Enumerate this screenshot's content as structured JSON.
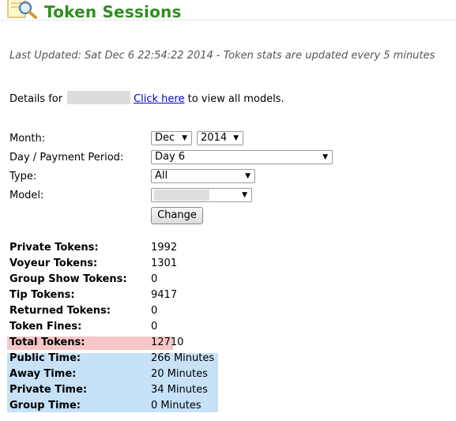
{
  "header": {
    "icon": "magnifier-document-icon",
    "title": "Token Sessions"
  },
  "last_updated": "Last Updated: Sat Dec 6 22:54:22 2014 - Token stats are updated every 5 minutes",
  "details": {
    "prefix": "Details for",
    "link_text": "Click here",
    "suffix": "to view all models."
  },
  "form": {
    "month_label": "Month:",
    "month_value": "Dec",
    "year_value": "2014",
    "day_label": "Day / Payment Period:",
    "day_value": "Day 6",
    "type_label": "Type:",
    "type_value": "All",
    "model_label": "Model:",
    "change_button": "Change"
  },
  "stats": [
    {
      "label": "Private Tokens:",
      "value": "1992"
    },
    {
      "label": "Voyeur Tokens:",
      "value": "1301"
    },
    {
      "label": "Group Show Tokens:",
      "value": "0"
    },
    {
      "label": "Tip Tokens:",
      "value": "9417"
    },
    {
      "label": "Returned Tokens:",
      "value": "0"
    },
    {
      "label": "Token Fines:",
      "value": "0"
    },
    {
      "label": "Total Tokens:",
      "value": "12710"
    },
    {
      "label": "Public Time:",
      "value": "266 Minutes"
    },
    {
      "label": "Away Time:",
      "value": "20 Minutes"
    },
    {
      "label": "Private Time:",
      "value": "34 Minutes"
    },
    {
      "label": "Group Time:",
      "value": "0 Minutes"
    }
  ],
  "colors": {
    "title_green": "#2f8f1f",
    "total_highlight": "#f7c6c6",
    "time_highlight": "#c7e1f7",
    "link": "#0000cc"
  }
}
